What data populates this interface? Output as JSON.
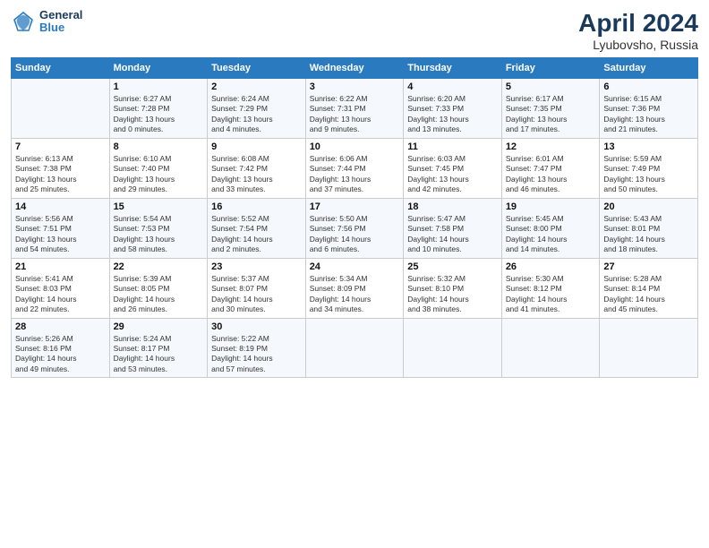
{
  "header": {
    "logo_general": "General",
    "logo_blue": "Blue",
    "title": "April 2024",
    "subtitle": "Lyubovsho, Russia"
  },
  "columns": [
    "Sunday",
    "Monday",
    "Tuesday",
    "Wednesday",
    "Thursday",
    "Friday",
    "Saturday"
  ],
  "weeks": [
    [
      {
        "day": "",
        "info": ""
      },
      {
        "day": "1",
        "info": "Sunrise: 6:27 AM\nSunset: 7:28 PM\nDaylight: 13 hours\nand 0 minutes."
      },
      {
        "day": "2",
        "info": "Sunrise: 6:24 AM\nSunset: 7:29 PM\nDaylight: 13 hours\nand 4 minutes."
      },
      {
        "day": "3",
        "info": "Sunrise: 6:22 AM\nSunset: 7:31 PM\nDaylight: 13 hours\nand 9 minutes."
      },
      {
        "day": "4",
        "info": "Sunrise: 6:20 AM\nSunset: 7:33 PM\nDaylight: 13 hours\nand 13 minutes."
      },
      {
        "day": "5",
        "info": "Sunrise: 6:17 AM\nSunset: 7:35 PM\nDaylight: 13 hours\nand 17 minutes."
      },
      {
        "day": "6",
        "info": "Sunrise: 6:15 AM\nSunset: 7:36 PM\nDaylight: 13 hours\nand 21 minutes."
      }
    ],
    [
      {
        "day": "7",
        "info": "Sunrise: 6:13 AM\nSunset: 7:38 PM\nDaylight: 13 hours\nand 25 minutes."
      },
      {
        "day": "8",
        "info": "Sunrise: 6:10 AM\nSunset: 7:40 PM\nDaylight: 13 hours\nand 29 minutes."
      },
      {
        "day": "9",
        "info": "Sunrise: 6:08 AM\nSunset: 7:42 PM\nDaylight: 13 hours\nand 33 minutes."
      },
      {
        "day": "10",
        "info": "Sunrise: 6:06 AM\nSunset: 7:44 PM\nDaylight: 13 hours\nand 37 minutes."
      },
      {
        "day": "11",
        "info": "Sunrise: 6:03 AM\nSunset: 7:45 PM\nDaylight: 13 hours\nand 42 minutes."
      },
      {
        "day": "12",
        "info": "Sunrise: 6:01 AM\nSunset: 7:47 PM\nDaylight: 13 hours\nand 46 minutes."
      },
      {
        "day": "13",
        "info": "Sunrise: 5:59 AM\nSunset: 7:49 PM\nDaylight: 13 hours\nand 50 minutes."
      }
    ],
    [
      {
        "day": "14",
        "info": "Sunrise: 5:56 AM\nSunset: 7:51 PM\nDaylight: 13 hours\nand 54 minutes."
      },
      {
        "day": "15",
        "info": "Sunrise: 5:54 AM\nSunset: 7:53 PM\nDaylight: 13 hours\nand 58 minutes."
      },
      {
        "day": "16",
        "info": "Sunrise: 5:52 AM\nSunset: 7:54 PM\nDaylight: 14 hours\nand 2 minutes."
      },
      {
        "day": "17",
        "info": "Sunrise: 5:50 AM\nSunset: 7:56 PM\nDaylight: 14 hours\nand 6 minutes."
      },
      {
        "day": "18",
        "info": "Sunrise: 5:47 AM\nSunset: 7:58 PM\nDaylight: 14 hours\nand 10 minutes."
      },
      {
        "day": "19",
        "info": "Sunrise: 5:45 AM\nSunset: 8:00 PM\nDaylight: 14 hours\nand 14 minutes."
      },
      {
        "day": "20",
        "info": "Sunrise: 5:43 AM\nSunset: 8:01 PM\nDaylight: 14 hours\nand 18 minutes."
      }
    ],
    [
      {
        "day": "21",
        "info": "Sunrise: 5:41 AM\nSunset: 8:03 PM\nDaylight: 14 hours\nand 22 minutes."
      },
      {
        "day": "22",
        "info": "Sunrise: 5:39 AM\nSunset: 8:05 PM\nDaylight: 14 hours\nand 26 minutes."
      },
      {
        "day": "23",
        "info": "Sunrise: 5:37 AM\nSunset: 8:07 PM\nDaylight: 14 hours\nand 30 minutes."
      },
      {
        "day": "24",
        "info": "Sunrise: 5:34 AM\nSunset: 8:09 PM\nDaylight: 14 hours\nand 34 minutes."
      },
      {
        "day": "25",
        "info": "Sunrise: 5:32 AM\nSunset: 8:10 PM\nDaylight: 14 hours\nand 38 minutes."
      },
      {
        "day": "26",
        "info": "Sunrise: 5:30 AM\nSunset: 8:12 PM\nDaylight: 14 hours\nand 41 minutes."
      },
      {
        "day": "27",
        "info": "Sunrise: 5:28 AM\nSunset: 8:14 PM\nDaylight: 14 hours\nand 45 minutes."
      }
    ],
    [
      {
        "day": "28",
        "info": "Sunrise: 5:26 AM\nSunset: 8:16 PM\nDaylight: 14 hours\nand 49 minutes."
      },
      {
        "day": "29",
        "info": "Sunrise: 5:24 AM\nSunset: 8:17 PM\nDaylight: 14 hours\nand 53 minutes."
      },
      {
        "day": "30",
        "info": "Sunrise: 5:22 AM\nSunset: 8:19 PM\nDaylight: 14 hours\nand 57 minutes."
      },
      {
        "day": "",
        "info": ""
      },
      {
        "day": "",
        "info": ""
      },
      {
        "day": "",
        "info": ""
      },
      {
        "day": "",
        "info": ""
      }
    ]
  ]
}
